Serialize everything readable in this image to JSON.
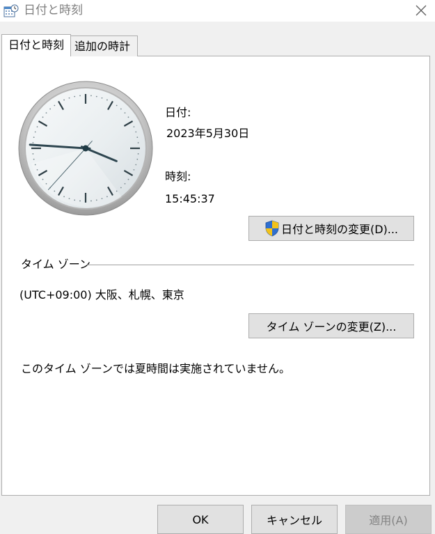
{
  "window": {
    "title": "日付と時刻",
    "close_icon": "close-icon"
  },
  "tabs": [
    {
      "label": "日付と時刻",
      "selected": true
    },
    {
      "label": "追加の時計",
      "selected": false
    }
  ],
  "datetime": {
    "date_label": "日付:",
    "date_value": "2023年5月30日",
    "time_label": "時刻:",
    "time_value": "15:45:37",
    "change_button_label": "日付と時刻の変更(D)...",
    "change_button_icon": "uac-shield-icon"
  },
  "clock": {
    "hours": 15,
    "minutes": 45,
    "seconds": 37
  },
  "timezone": {
    "section_title": "タイム ゾーン",
    "value": "(UTC+09:00) 大阪、札幌、東京",
    "change_button_label": "タイム ゾーンの変更(Z)...",
    "dst_note": "このタイム ゾーンでは夏時間は実施されていません。"
  },
  "footer": {
    "ok_label": "OK",
    "cancel_label": "キャンセル",
    "apply_label": "適用(A)",
    "apply_enabled": false
  }
}
